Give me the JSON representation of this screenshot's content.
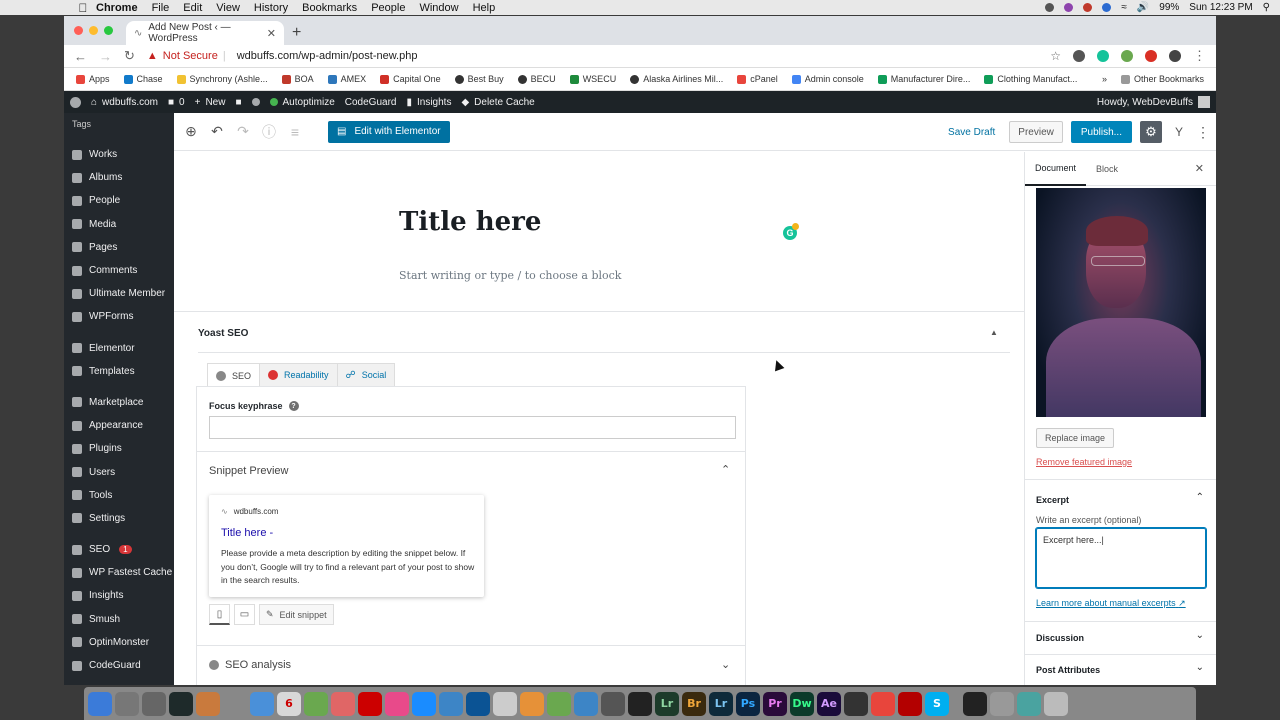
{
  "macmenu": {
    "items": [
      "Chrome",
      "File",
      "Edit",
      "View",
      "History",
      "Bookmarks",
      "People",
      "Window",
      "Help"
    ],
    "battery": "99%",
    "clock": "Sun 12:23 PM"
  },
  "browser": {
    "tab_title": "Add New Post ‹ — WordPress",
    "not_secure": "Not Secure",
    "url": "wdbuffs.com/wp-admin/post-new.php",
    "bookmarks": [
      "Apps",
      "Chase",
      "Synchrony (Ashle...",
      "BOA",
      "AMEX",
      "Capital One",
      "Best Buy",
      "BECU",
      "WSECU",
      "Alaska Airlines Mil...",
      "cPanel",
      "Admin console",
      "Manufacturer Dire...",
      "Clothing Manufact..."
    ],
    "bookmarks_more": "»",
    "other_bookmarks": "Other Bookmarks"
  },
  "adminbar": {
    "site": "wdbuffs.com",
    "comments": "0",
    "new": "New",
    "autoptimize": "Autoptimize",
    "codeguard": "CodeGuard",
    "insights": "Insights",
    "delete_cache": "Delete Cache",
    "howdy": "Howdy, WebDevBuffs"
  },
  "sidebar": {
    "tags": "Tags",
    "group1": [
      "Works",
      "Albums",
      "People",
      "Media",
      "Pages",
      "Comments",
      "Ultimate Member",
      "WPForms"
    ],
    "group2": [
      "Elementor",
      "Templates"
    ],
    "group3": [
      "Marketplace",
      "Appearance",
      "Plugins",
      "Users",
      "Tools",
      "Settings"
    ],
    "group4": [
      "SEO",
      "WP Fastest Cache",
      "Insights",
      "Smush",
      "OptinMonster",
      "CodeGuard"
    ],
    "seo_badge": "1"
  },
  "toolbar": {
    "elementor": "Edit with Elementor",
    "save_draft": "Save Draft",
    "preview": "Preview",
    "publish": "Publish..."
  },
  "post": {
    "title": "Title here",
    "block_placeholder": "Start writing or type / to choose a block"
  },
  "yoast": {
    "header": "Yoast SEO",
    "tabs": [
      "SEO",
      "Readability",
      "Social"
    ],
    "focus_label": "Focus keyphrase",
    "snippet_header": "Snippet Preview",
    "snippet_url": "wdbuffs.com",
    "snippet_title": "Title here -",
    "snippet_desc": "Please provide a meta description by editing the snippet below. If you don’t, Google will try to find a relevant part of your post to show in the search results.",
    "edit_snippet": "Edit snippet",
    "seo_analysis": "SEO analysis"
  },
  "settings": {
    "tab_document": "Document",
    "tab_block": "Block",
    "replace_image": "Replace image",
    "remove_image": "Remove featured image",
    "excerpt_title": "Excerpt",
    "excerpt_label": "Write an excerpt (optional)",
    "excerpt_value": "Excerpt here...|",
    "learn_more": "Learn more about manual excerpts",
    "discussion": "Discussion",
    "post_attributes": "Post Attributes"
  },
  "dock": {
    "labels": [
      "Lr",
      "Br",
      "Lr",
      "Ps",
      "Pr",
      "Dw",
      "Ae",
      "S"
    ],
    "calendar_day": "6"
  },
  "colors": {
    "wp_dark": "#23282d",
    "wp_blue": "#0085ba",
    "link_blue": "#0073aa",
    "danger": "#d94f4f"
  }
}
